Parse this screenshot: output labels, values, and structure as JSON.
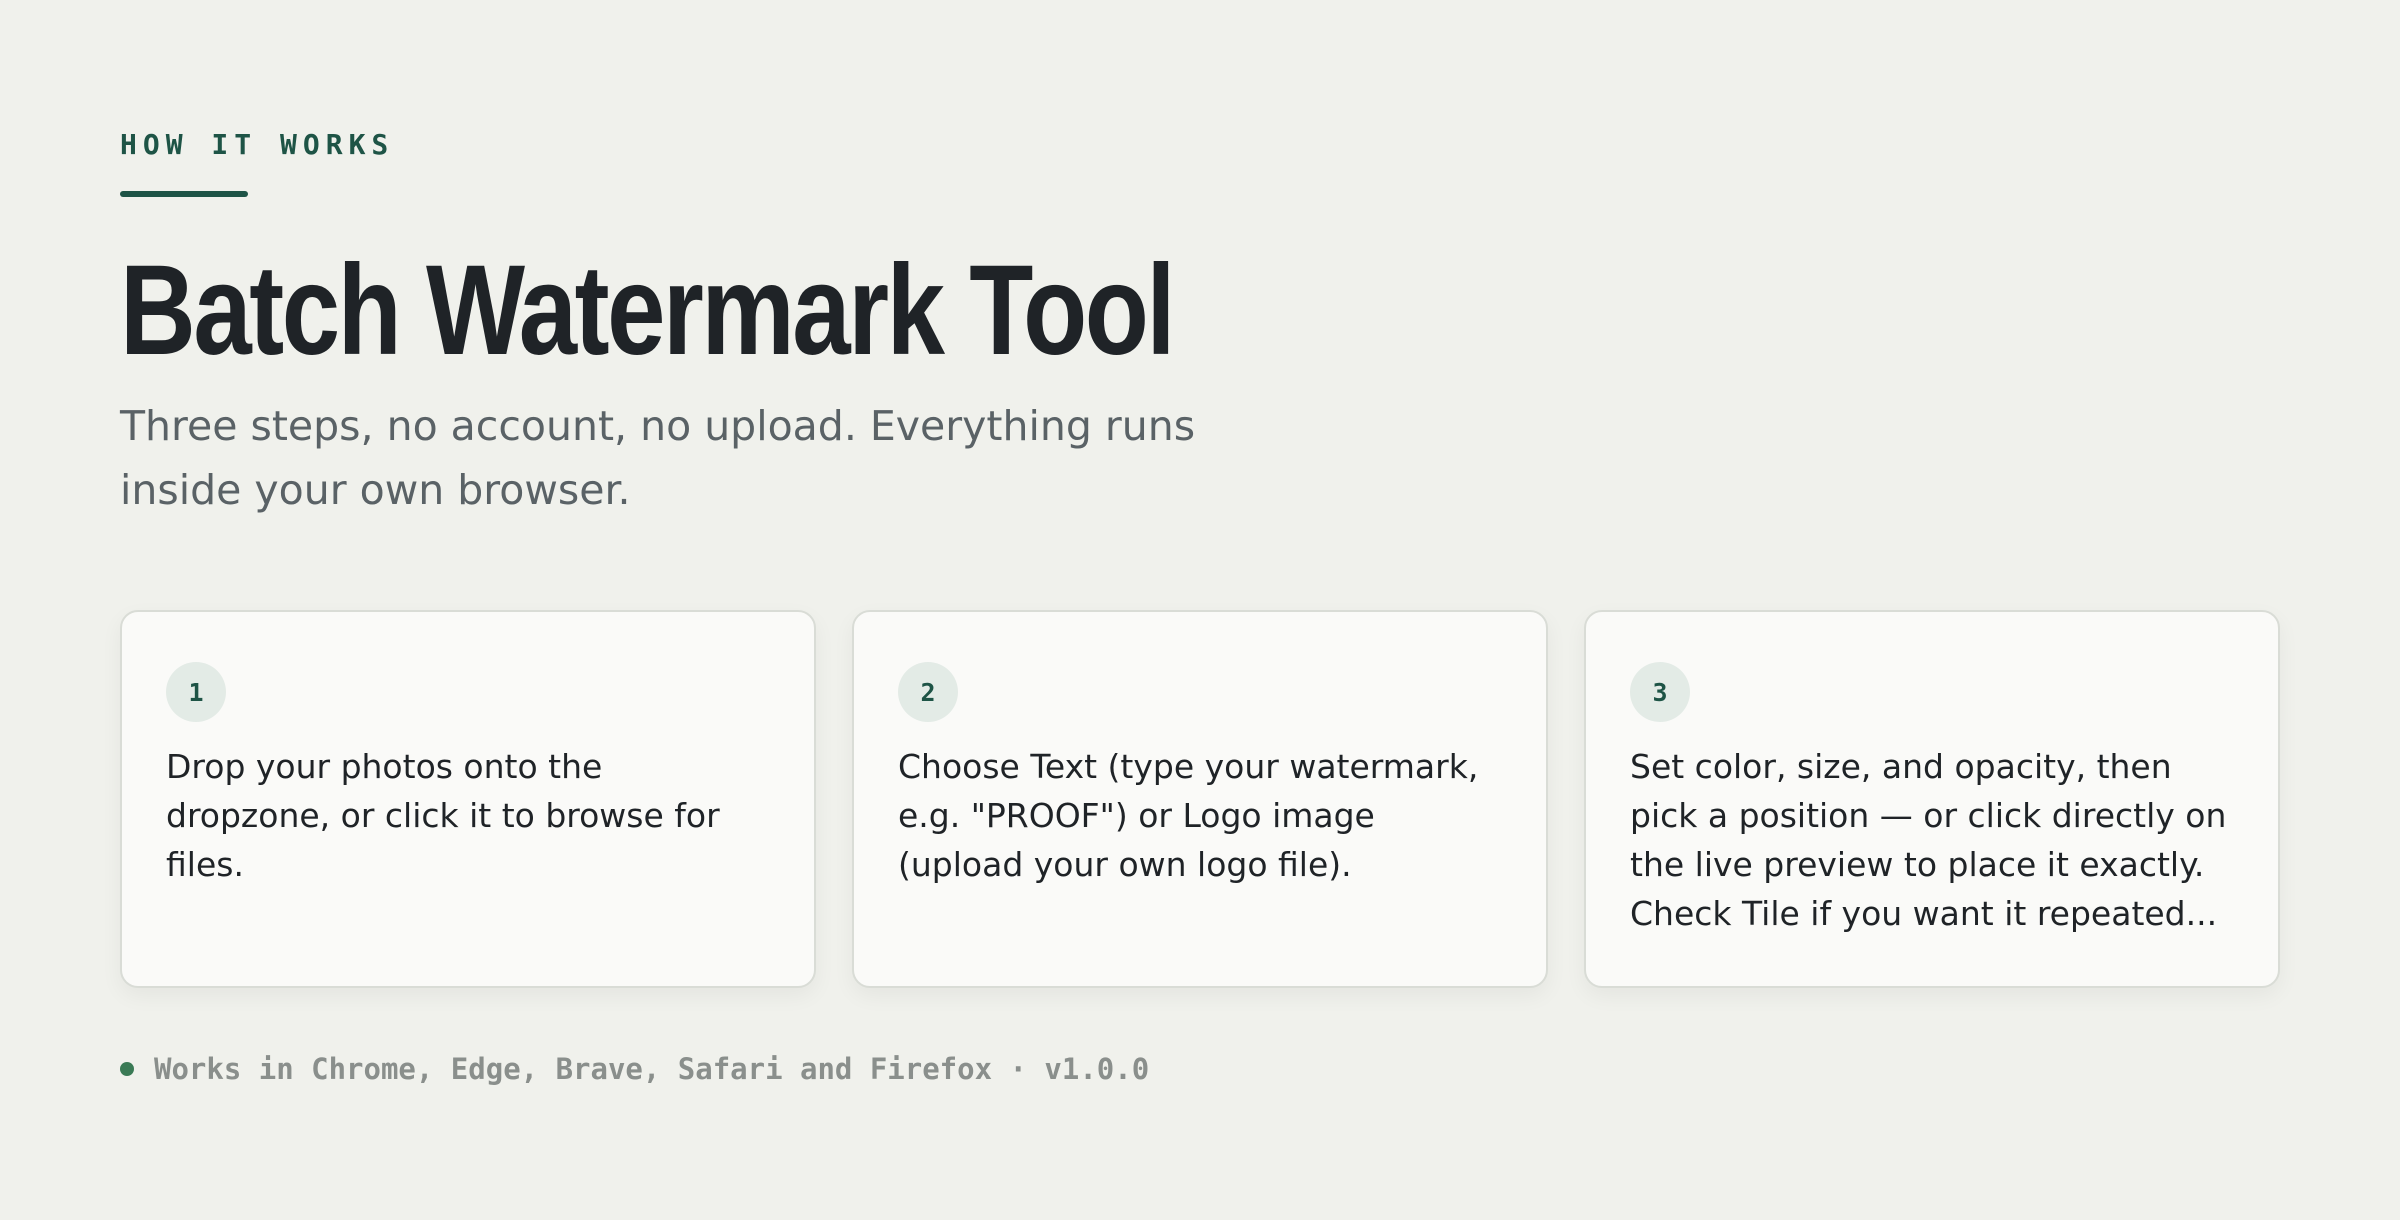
{
  "section": {
    "eyebrow": "HOW IT WORKS",
    "title": "Batch Watermark Tool",
    "subtitle": "Three steps, no account, no upload. Everything runs inside your own browser."
  },
  "steps": [
    {
      "number": "1",
      "text": "Drop your photos onto the dropzone, or click it to browse for files."
    },
    {
      "number": "2",
      "text": "Choose Text (type your watermark, e.g. \"PROOF\") or Logo image (upload your own logo file)."
    },
    {
      "number": "3",
      "text": "Set color, size, and opacity, then pick a position — or click directly on the live preview to place it exactly. Check Tile if you want it repeated..."
    }
  ],
  "footer": {
    "compatibility": "Works in Chrome, Edge, Brave, Safari and Firefox · v1.0.0"
  },
  "colors": {
    "background": "#f0f1ec",
    "accent": "#1e5446",
    "status_dot": "#3a7a55"
  }
}
